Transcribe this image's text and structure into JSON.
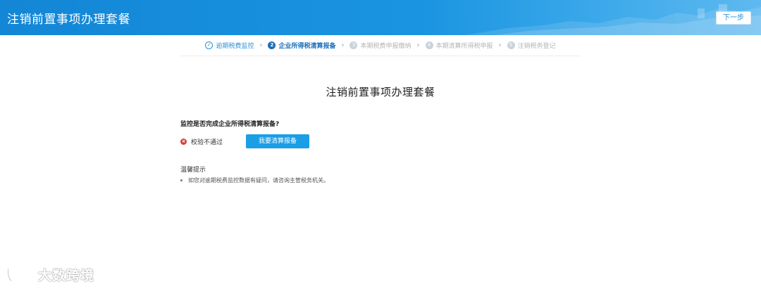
{
  "header": {
    "title": "注销前置事项办理套餐",
    "next_label": "下一步"
  },
  "steps": [
    {
      "icon": "✓",
      "label": "逾期税费监控",
      "state": "done"
    },
    {
      "icon": "2",
      "label": "企业所得税清算报备",
      "state": "active"
    },
    {
      "icon": "3",
      "label": "本期税费申报缴纳",
      "state": "pending"
    },
    {
      "icon": "4",
      "label": "本期清算所得税申报",
      "state": "pending"
    },
    {
      "icon": "5",
      "label": "注销税务登记",
      "state": "pending"
    }
  ],
  "step_separator": "›",
  "main": {
    "title": "注销前置事项办理套餐",
    "question": "监控是否完成企业所得税清算报备?",
    "result_icon": "×",
    "result_text": "校验不通过",
    "action_label": "我要清算报备"
  },
  "tips": {
    "title": "温馨提示",
    "items": [
      "如您对逾期税费监控数据有疑问，请咨询主管税务机关。"
    ]
  },
  "watermark": {
    "text": "大数跨境"
  },
  "colors": {
    "header_blue": "#1386d6",
    "accent_blue": "#1a9ee6",
    "error_red": "#e23b3b",
    "done_blue": "#2f8fd6",
    "pending_gray": "#b4b4b4"
  }
}
